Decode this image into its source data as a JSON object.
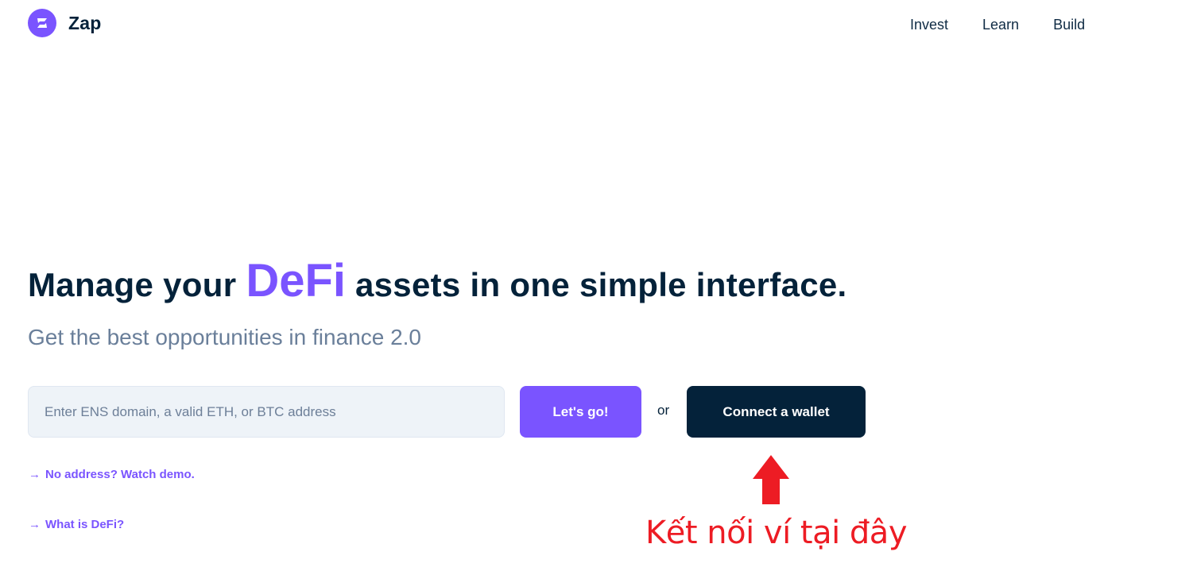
{
  "brand": {
    "name": "Zap",
    "logo_icon": "zap-logo-icon",
    "accent_color": "#7a54ff",
    "dark_color": "#04223a"
  },
  "nav": {
    "items": [
      {
        "label": "Invest"
      },
      {
        "label": "Learn"
      },
      {
        "label": "Build"
      }
    ]
  },
  "hero": {
    "headline_before": "Manage your ",
    "headline_accent": "DeFi",
    "headline_after": " assets in one simple interface.",
    "subtitle": "Get the best opportunities in finance 2.0",
    "address_input": {
      "value": "",
      "placeholder": "Enter ENS domain, a valid ETH, or BTC address"
    },
    "go_label": "Let's go!",
    "or_label": "or",
    "connect_label": "Connect a wallet",
    "links": [
      {
        "arrow": "→",
        "label": "No address? Watch demo."
      },
      {
        "arrow": "→",
        "label": "What is DeFi?"
      }
    ]
  },
  "annotation": {
    "arrow_icon": "red-up-arrow-icon",
    "text": "Kết nối ví tại đây",
    "color": "#ed1c24"
  }
}
